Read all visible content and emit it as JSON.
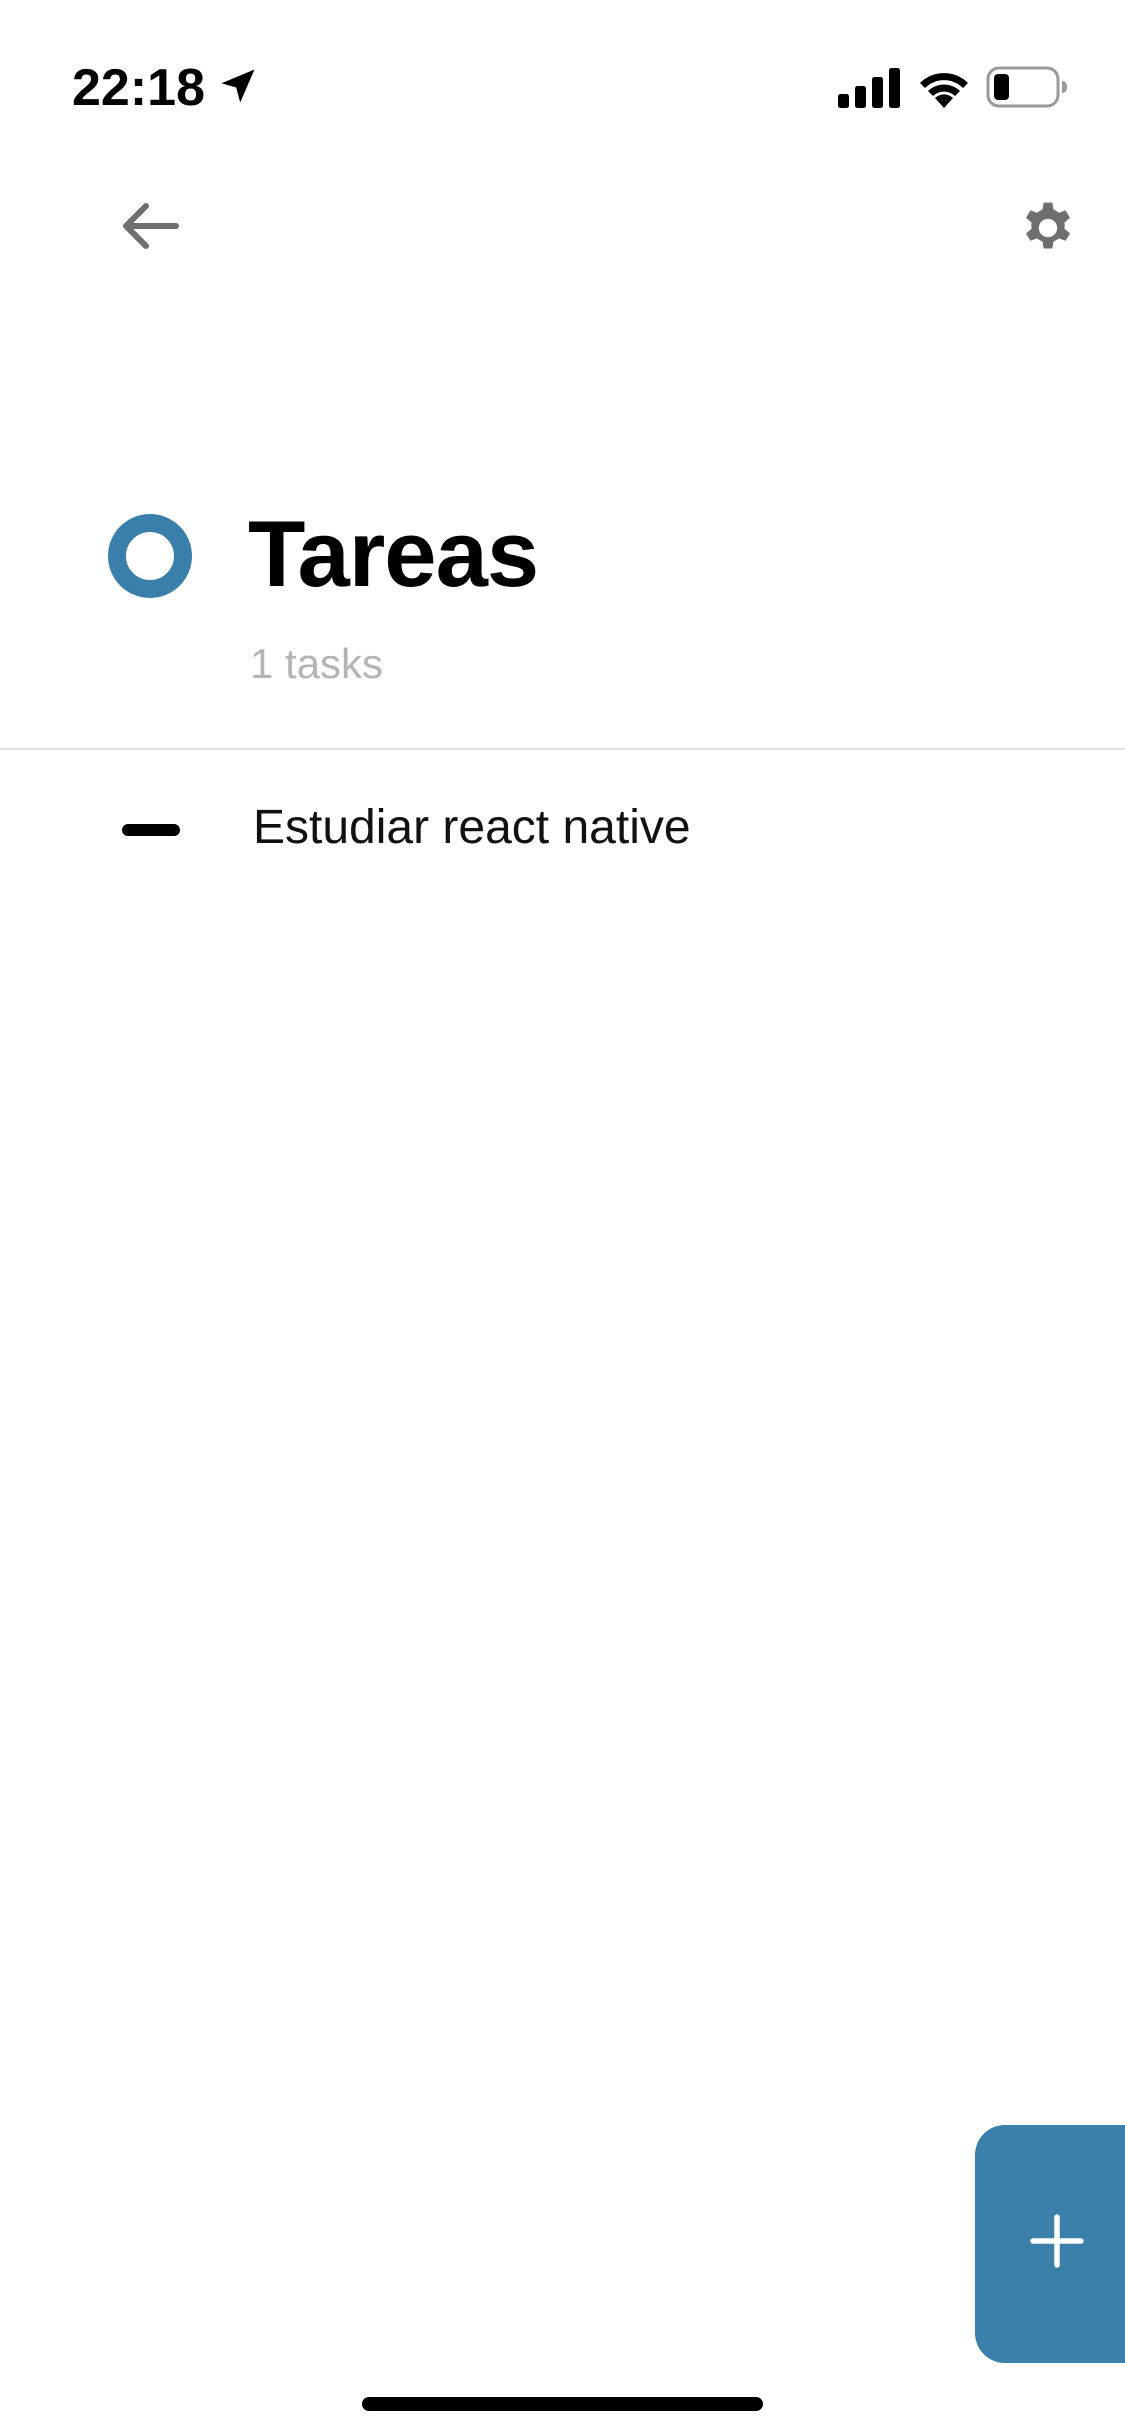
{
  "status_bar": {
    "time": "22:18",
    "icons": [
      "location-arrow-icon",
      "cellular-signal-icon",
      "wifi-icon",
      "battery-icon"
    ]
  },
  "nav": {
    "back_icon": "arrow-left-icon",
    "settings_icon": "gear-icon"
  },
  "header": {
    "title": "Tareas",
    "subtitle": "1 tasks",
    "icon": "circle-ring-icon",
    "accent_color": "#3a7fab"
  },
  "tasks": [
    {
      "label": "Estudiar react native",
      "status_icon": "dash-icon"
    }
  ],
  "fab": {
    "icon": "plus-icon",
    "color": "#3b7fab"
  },
  "colors": {
    "background": "#ffffff",
    "text_primary": "#000000",
    "text_secondary": "#b4b4b4",
    "divider": "#e3e3e3"
  }
}
